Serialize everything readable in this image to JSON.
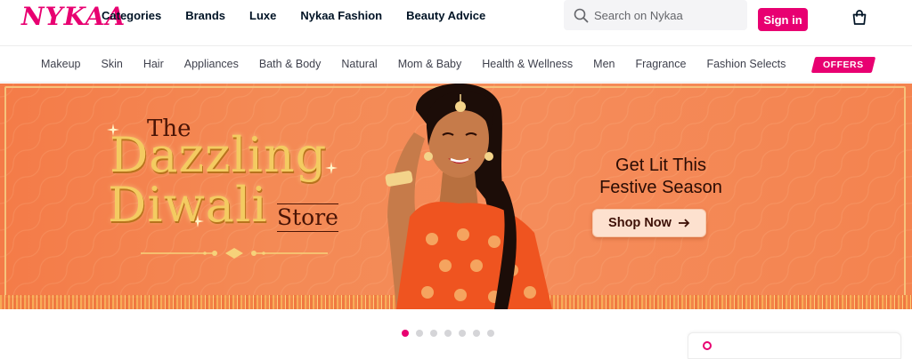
{
  "brand": {
    "logo_text": "NYKAA",
    "accent": "#e80071"
  },
  "header": {
    "nav": [
      "Categories",
      "Brands",
      "Luxe",
      "Nykaa Fashion",
      "Beauty Advice"
    ],
    "search_placeholder": "Search on Nykaa",
    "signin_label": "Sign in",
    "bag_icon": "shopping-bag-icon"
  },
  "categories": [
    "Makeup",
    "Skin",
    "Hair",
    "Appliances",
    "Bath & Body",
    "Natural",
    "Mom & Baby",
    "Health & Wellness",
    "Men",
    "Fragrance",
    "Fashion Selects"
  ],
  "offers_label": "OFFERS",
  "hero": {
    "the": "The",
    "line1": "Dazzling",
    "line2": "Diwali",
    "store": "Store",
    "tagline_1": "Get Lit This",
    "tagline_2": "Festive Season",
    "cta_label": "Shop Now",
    "cta_icon": "arrow-right-icon",
    "background_color": "#f48a55"
  },
  "carousel": {
    "slides": 7,
    "active_index": 0
  }
}
